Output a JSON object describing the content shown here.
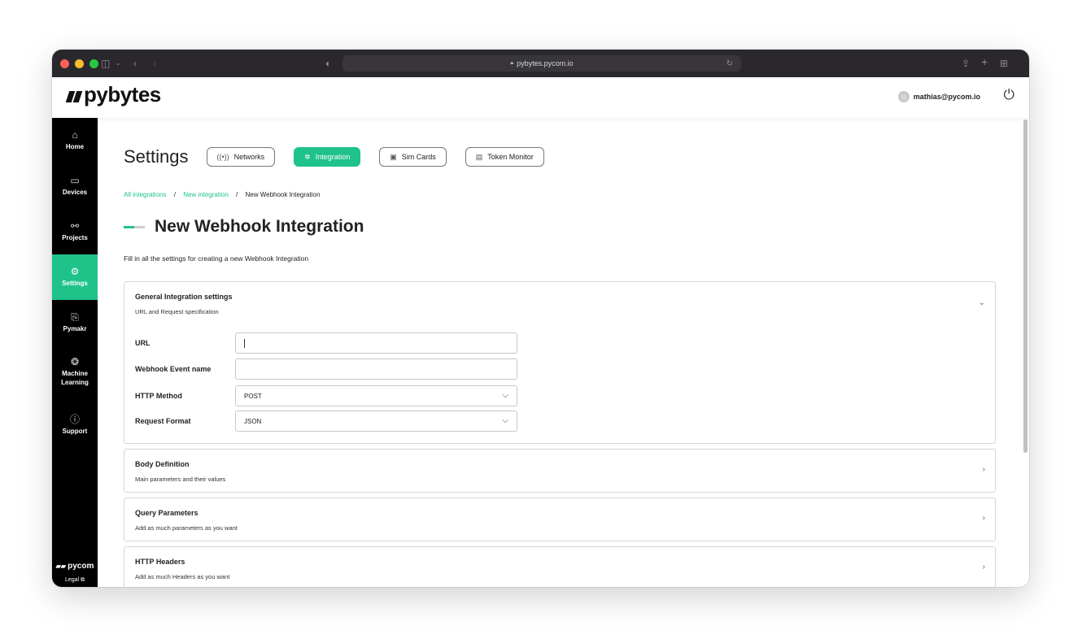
{
  "browser": {
    "url": "pybytes.pycom.io",
    "icons": [
      "sidebar-toggle-icon",
      "chevron-down-icon",
      "back-icon",
      "forward-icon",
      "shield-icon",
      "lock-icon",
      "reload-icon",
      "share-icon",
      "new-tab-icon",
      "tab-overview-icon"
    ]
  },
  "header": {
    "logo": "pybytes",
    "user_email": "mathias@pycom.io"
  },
  "sidebar": {
    "items": [
      {
        "label": "Home",
        "icon": "⌂"
      },
      {
        "label": "Devices",
        "icon": "▭"
      },
      {
        "label": "Projects",
        "icon": "⚯"
      },
      {
        "label": "Settings",
        "icon": "⚙",
        "active": true
      },
      {
        "label": "Pymakr",
        "icon": "⎘"
      },
      {
        "label": "Machine Learning",
        "icon": "❂"
      },
      {
        "label": "Support",
        "icon": "ⓘ"
      }
    ],
    "footer_brand": "pycom",
    "legal": "Legal"
  },
  "settings": {
    "title": "Settings",
    "tabs": [
      {
        "label": "Networks",
        "icon": "((•))"
      },
      {
        "label": "Integration",
        "icon": "✲",
        "active": true
      },
      {
        "label": "Sim Cards",
        "icon": "▣"
      },
      {
        "label": "Token Monitor",
        "icon": "▤"
      }
    ]
  },
  "breadcrumb": {
    "items": [
      "All integrations",
      "New integration",
      "New Webhook Integration"
    ],
    "separator": "/"
  },
  "page": {
    "title": "New Webhook Integration",
    "intro": "Fill in all the settings for creating a new Webhook Integration"
  },
  "panels": {
    "general": {
      "title": "General Integration settings",
      "subtitle": "URL and Request specification",
      "fields": {
        "url": {
          "label": "URL",
          "value": ""
        },
        "event": {
          "label": "Webhook Event name",
          "value": ""
        },
        "method": {
          "label": "HTTP Method",
          "value": "POST"
        },
        "format": {
          "label": "Request Format",
          "value": "JSON"
        }
      }
    },
    "body": {
      "title": "Body Definition",
      "subtitle": "Main parameters and their values"
    },
    "query": {
      "title": "Query Parameters",
      "subtitle": "Add as much parameters as you want"
    },
    "headers": {
      "title": "HTTP Headers",
      "subtitle": "Add as much Headers as you want"
    }
  },
  "colors": {
    "accent": "#1fc38a",
    "sidebar": "#000000",
    "titlebar": "#2a282d"
  }
}
